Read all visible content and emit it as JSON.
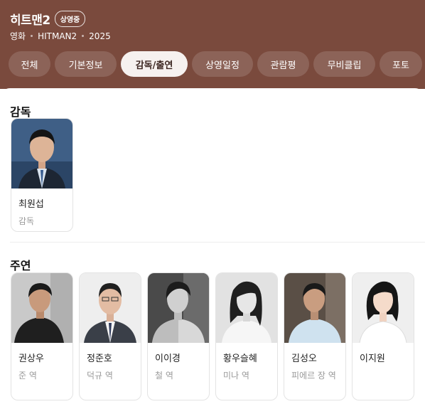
{
  "movie": {
    "title": "히트맨2",
    "status": "상영중",
    "genre": "영화",
    "english_title": "HITMAN2",
    "year": "2025"
  },
  "tabs": [
    {
      "label": "전체",
      "active": false
    },
    {
      "label": "기본정보",
      "active": false
    },
    {
      "label": "감독/출연",
      "active": true
    },
    {
      "label": "상영일정",
      "active": false
    },
    {
      "label": "관람평",
      "active": false
    },
    {
      "label": "무비클립",
      "active": false
    },
    {
      "label": "포토",
      "active": false
    }
  ],
  "director_section": {
    "title": "감독",
    "people": [
      {
        "name": "최원섭",
        "role": "감독"
      }
    ]
  },
  "cast_section": {
    "title": "주연",
    "people": [
      {
        "name": "권상우",
        "role": "준 역"
      },
      {
        "name": "정준호",
        "role": "덕규 역"
      },
      {
        "name": "이이경",
        "role": "철 역"
      },
      {
        "name": "황우슬혜",
        "role": "미나 역"
      },
      {
        "name": "김성오",
        "role": "피에르 장 역"
      },
      {
        "name": "이지원",
        "role": ""
      }
    ]
  },
  "colors": {
    "header_bg": "#7a4a3d",
    "tab_active_bg": "#f6f1ef"
  }
}
